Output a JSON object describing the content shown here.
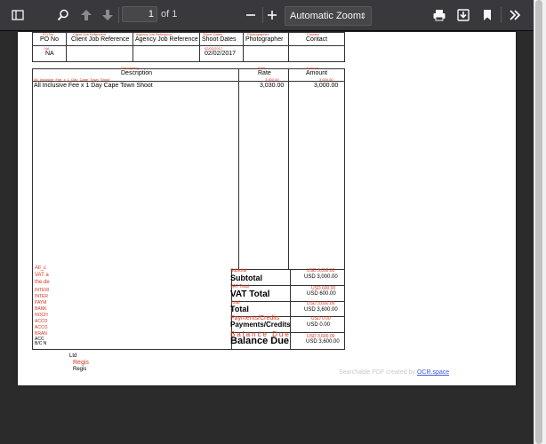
{
  "toolbar": {
    "page_current": "1",
    "page_of": "of 1",
    "zoom": "Automatic Zoom",
    "icons": [
      "sidebar-toggle-icon",
      "search-icon",
      "arrow-up-icon",
      "arrow-down-icon",
      "minus-icon",
      "plus-icon",
      "print-icon",
      "download-icon",
      "bookmark-icon",
      "chevrons-right-icon"
    ]
  },
  "doc": {
    "header_row1": [
      "PO No",
      "Client Job Reference",
      "Agency Job Reference",
      "Shoot Dates",
      "Photographer",
      "Contact"
    ],
    "header_row1_overlay": [
      "PO No",
      "Client Job Reference",
      "Agency Job Reference",
      "Shoot Dates",
      "Photographer",
      "Contact"
    ],
    "header_row2": [
      "NA",
      "02/02/2017"
    ],
    "header_row2_overlay": [
      "NA",
      "02/02/2017"
    ],
    "col_headers": [
      "Description",
      "Rate",
      "Amount"
    ],
    "col_headers_overlay": [
      "Description",
      "Rate",
      "Amount"
    ],
    "line_overlay": "All_Inclusive_Fee_x_1_Day_Cape_Town_Shoot",
    "line_item": {
      "description": "All Inclusive Fee x 1 Day Cape Town Shoot",
      "rate": "3,030.00",
      "amount": "3,000.00"
    },
    "line_item_overlay": {
      "rate": "3,000.00",
      "amount": "3,000.00"
    },
    "left_notes": [
      "All_c",
      "VAT a",
      "the.de",
      "INTERI",
      "INTER",
      "PAYM",
      "BANK",
      "NOCH",
      "ACCO",
      "ACCO",
      "BRAN",
      "ACC",
      "B/C N"
    ],
    "bottom_left": [
      "Ltd",
      "Regis",
      "Regis"
    ],
    "totals": [
      {
        "overlay": "Subtotal",
        "label": "Subtotal",
        "overlay_value": "USD 3,000.00",
        "value": "USD 3,000.00"
      },
      {
        "overlay": "VAT Total",
        "label": "VAT Total",
        "overlay_value": "USD 600.00",
        "value": "USD 600.00"
      },
      {
        "overlay": "Total",
        "label": "Total",
        "overlay_value": "USD 3,600.00",
        "value": "USD 3,600.00"
      },
      {
        "overlay": "Payments/Credits",
        "label": "Payments/Credits",
        "overlay_value": "USD 0.00",
        "value": "USD 0.00"
      },
      {
        "overlay": "Balance Due",
        "label": "Balance Due",
        "overlay_value": "USD 3,600.00",
        "value": "USD 3,600.00"
      }
    ],
    "ocr_text": "Searchable PDF created by",
    "ocr_link": "OCR.space"
  }
}
